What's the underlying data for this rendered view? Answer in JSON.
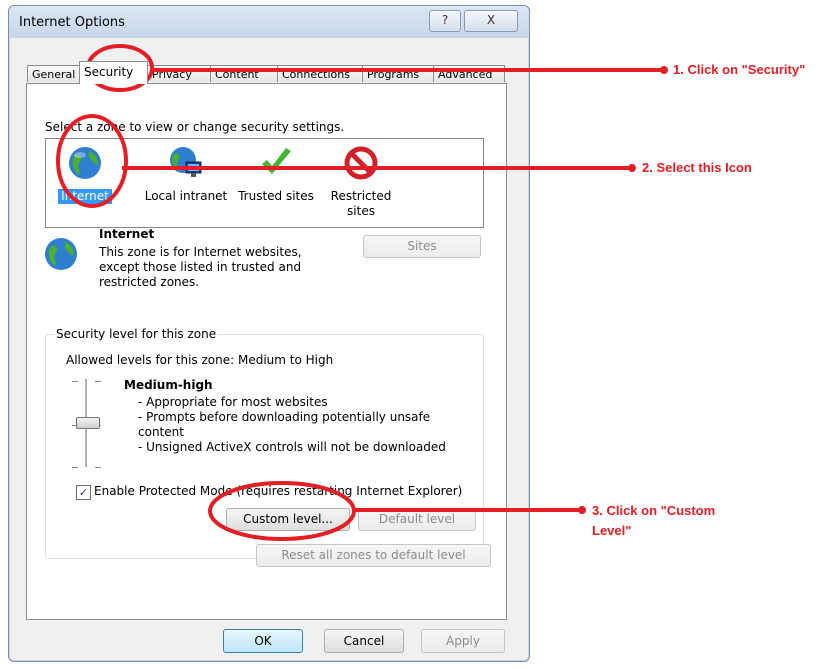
{
  "window": {
    "title": "Internet Options",
    "help_glyph": "?",
    "close_glyph": "X"
  },
  "tabs": [
    "General",
    "Security",
    "Privacy",
    "Content",
    "Connections",
    "Programs",
    "Advanced"
  ],
  "active_tab": "Security",
  "security": {
    "zone_prompt": "Select a zone to view or change security settings.",
    "zones": [
      {
        "label": "Internet",
        "icon": "globe-icon",
        "selected": true
      },
      {
        "label": "Local intranet",
        "icon": "intranet-globe-icon"
      },
      {
        "label": "Trusted sites",
        "icon": "green-check-icon"
      },
      {
        "label": "Restricted sites",
        "icon": "red-prohibit-icon"
      }
    ],
    "zone_title": "Internet",
    "zone_description": "This zone is for Internet websites, except those listed in trusted and restricted zones.",
    "sites_button": "Sites",
    "level_group_label": "Security level for this zone",
    "allowed_levels": "Allowed levels for this zone: Medium to High",
    "level_name": "Medium-high",
    "level_bullets": [
      "- Appropriate for most websites",
      "- Prompts before downloading potentially unsafe content",
      "- Unsigned ActiveX controls will not be downloaded"
    ],
    "protected_mode_label": "Enable Protected Mode (requires restarting Internet Explorer)",
    "protected_mode_checked": true,
    "custom_level_button": "Custom level...",
    "default_level_button": "Default level",
    "reset_button": "Reset all zones to default level"
  },
  "footer": {
    "ok": "OK",
    "cancel": "Cancel",
    "apply": "Apply"
  },
  "annotations": {
    "step1": "1. Click on \"Security\"",
    "step2": "2. Select this Icon",
    "step3_line1": "3. Click on \"Custom",
    "step3_line2": "Level\"",
    "color": "#e31e24"
  }
}
